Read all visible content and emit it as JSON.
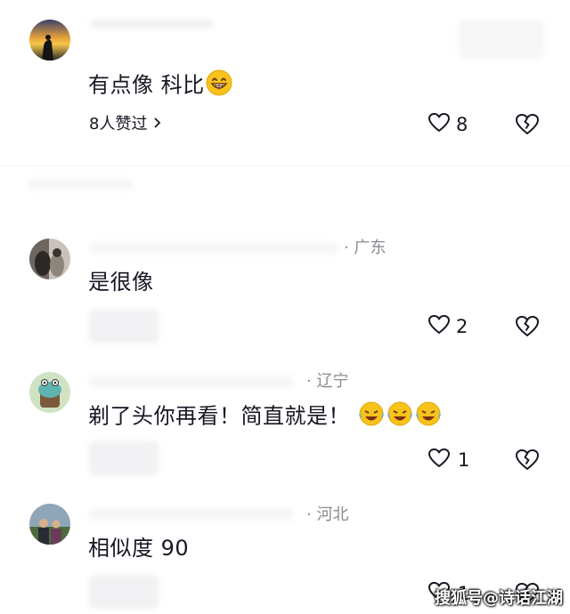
{
  "comments": [
    {
      "text": "有点像 科比",
      "likes_summary": "8人赞过",
      "like_count": "8",
      "region": ""
    },
    {
      "text": "是很像",
      "region": "· 广东",
      "like_count": "2"
    },
    {
      "text": "剃了头你再看！简直就是！",
      "region": "· 辽宁",
      "like_count": "1"
    },
    {
      "text": "相似度 90",
      "region": "· 河北",
      "like_count": "1"
    }
  ],
  "watermark": "搜狐号@诗话江湖",
  "colors": {
    "text": "#161823",
    "muted": "#8a8b91",
    "emoji_yellow": "#f7c21a"
  }
}
